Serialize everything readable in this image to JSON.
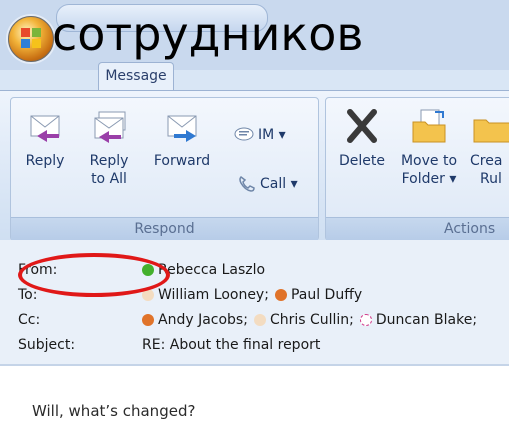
{
  "overlay_title": "сотрудников",
  "tab": {
    "label": "Message"
  },
  "ribbon": {
    "respond": {
      "label": "Respond",
      "reply": "Reply",
      "reply_all_1": "Reply",
      "reply_all_2": "to All",
      "forward": "Forward",
      "im": "IM ▾",
      "call": "Call ▾"
    },
    "actions": {
      "label": "Actions",
      "delete": "Delete",
      "move_1": "Move to",
      "move_2": "Folder ▾",
      "create_1": "Crea",
      "create_2": "Rul"
    }
  },
  "fields": {
    "from_label": "From:",
    "from_value": "Rebecca Laszlo",
    "to_label": "To:",
    "to_1": "William Looney;",
    "to_2": "Paul Duffy",
    "cc_label": "Cc:",
    "cc_1": "Andy Jacobs;",
    "cc_2": "Chris Cullin;",
    "cc_3": "Duncan Blake;",
    "subject_label": "Subject:",
    "subject_value": "RE: About the final report"
  },
  "body": {
    "text": "Will, what’s changed?"
  },
  "colors": {
    "highlight": "#e01818",
    "presence_online": "#44b02c",
    "presence_busy": "#e0732a"
  }
}
